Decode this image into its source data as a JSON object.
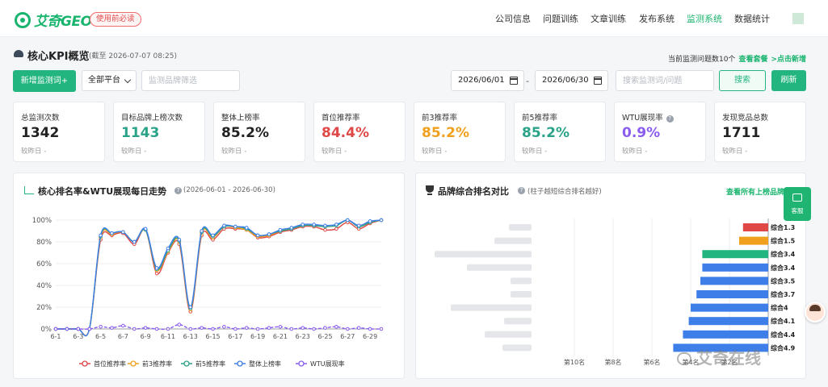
{
  "topnav": {
    "logo_text": "艾奇GEO",
    "must_read": "使用前必读",
    "items": [
      "公司信息",
      "问题训练",
      "文章训练",
      "发布系统",
      "监测系统",
      "数据统计"
    ],
    "active_index": 4
  },
  "header": {
    "title": "核心KPI概览",
    "as_of": "(截至 2026-07-07 08:25)",
    "monitor_count": "当前监测问题数10个",
    "view_plan": "查看套餐",
    "add_link": ">点击新增"
  },
  "toolbar": {
    "add_button": "新增监测词+",
    "platform_select": "全部平台",
    "brand_filter_placeholder": "监测品牌筛选",
    "date_start": "2026/06/01",
    "date_end": "2026/06/30",
    "date_sep": "-",
    "search_placeholder": "搜索监测词/问题",
    "search_button": "搜索",
    "refresh_button": "刷新"
  },
  "kpis": [
    {
      "label": "总监测次数",
      "value": "1342",
      "sub": "较昨日 -",
      "color": "#222222",
      "help": false
    },
    {
      "label": "目标品牌上榜次数",
      "value": "1143",
      "sub": "较昨日 -",
      "color": "#2aa388",
      "help": false
    },
    {
      "label": "整体上榜率",
      "value": "85.2%",
      "sub": "较昨日 -",
      "color": "#222222",
      "help": false
    },
    {
      "label": "首位推荐率",
      "value": "84.4%",
      "sub": "较昨日 -",
      "color": "#e04848",
      "help": false
    },
    {
      "label": "前3推荐率",
      "value": "85.2%",
      "sub": "较昨日 -",
      "color": "#f0a01c",
      "help": false
    },
    {
      "label": "前5推荐率",
      "value": "85.2%",
      "sub": "较昨日 -",
      "color": "#2aa388",
      "help": false
    },
    {
      "label": "WTU展现率",
      "value": "0.9%",
      "sub": "较昨日 -",
      "color": "#8a5cf0",
      "help": true
    },
    {
      "label": "发现竞品总数",
      "value": "1711",
      "sub": "较昨日 -",
      "color": "#222222",
      "help": false
    }
  ],
  "trend_panel": {
    "title": "核心排名率&WTU展现每日走势",
    "range": "(2026-06-01 - 2026-06-30)"
  },
  "ranking_panel": {
    "title": "品牌综合排名对比",
    "subtitle": "(柱子越短综合排名越好)",
    "view_all": "查看所有上榜品牌"
  },
  "chart_data": [
    {
      "type": "line",
      "title": "核心排名率&WTU展现每日走势",
      "x": [
        "6-1",
        "6-2",
        "6-3",
        "6-4",
        "6-5",
        "6-6",
        "6-7",
        "6-8",
        "6-9",
        "6-10",
        "6-11",
        "6-12",
        "6-13",
        "6-14",
        "6-15",
        "6-16",
        "6-17",
        "6-18",
        "6-19",
        "6-20",
        "6-21",
        "6-22",
        "6-23",
        "6-24",
        "6-25",
        "6-26",
        "6-27",
        "6-28",
        "6-29",
        "6-30"
      ],
      "x_tick_labels": [
        "6-1",
        "6-3",
        "6-5",
        "6-7",
        "6-9",
        "6-11",
        "6-13",
        "6-15",
        "6-17",
        "6-19",
        "6-21",
        "6-23",
        "6-25",
        "6-27",
        "6-29"
      ],
      "ylim": [
        0,
        100
      ],
      "y_ticks": [
        "0%",
        "20%",
        "40%",
        "60%",
        "80%",
        "100%"
      ],
      "legend_position": "bottom",
      "grid": true,
      "series": [
        {
          "name": "首位推荐率",
          "color": "#e04848",
          "values": [
            0,
            0,
            0,
            0,
            82,
            86,
            88,
            78,
            91,
            51,
            70,
            78,
            16,
            86,
            82,
            92,
            92,
            91,
            84,
            85,
            89,
            91,
            94,
            94,
            91,
            92,
            98,
            92,
            97,
            100
          ]
        },
        {
          "name": "前3推荐率",
          "color": "#f0a01c",
          "values": [
            0,
            0,
            0,
            0,
            84,
            87,
            89,
            80,
            91,
            54,
            71,
            80,
            18,
            88,
            84,
            94,
            93,
            91,
            85,
            86,
            90,
            92,
            95,
            95,
            94,
            95,
            100,
            94,
            98,
            100
          ]
        },
        {
          "name": "前5推荐率",
          "color": "#2aa388",
          "values": [
            0,
            0,
            0,
            0,
            85,
            88,
            89,
            80,
            91,
            55,
            72,
            81,
            19,
            89,
            85,
            94,
            94,
            92,
            86,
            87,
            90,
            92,
            95,
            95,
            94,
            95,
            100,
            94,
            98,
            100
          ]
        },
        {
          "name": "整体上榜率",
          "color": "#3d7ee8",
          "values": [
            0,
            0,
            0,
            0,
            86,
            88,
            89,
            80,
            92,
            56,
            74,
            82,
            20,
            90,
            86,
            95,
            94,
            93,
            86,
            87,
            91,
            93,
            96,
            96,
            95,
            96,
            100,
            95,
            99,
            100
          ]
        },
        {
          "name": "WTU展现率",
          "color": "#8a5cf0",
          "values": [
            0,
            0,
            0,
            0,
            2,
            1,
            3,
            0,
            1,
            0,
            0,
            4,
            0,
            1,
            0,
            2,
            0,
            1,
            0,
            1,
            2,
            0,
            1,
            0,
            1,
            2,
            0,
            1,
            0,
            0
          ]
        }
      ]
    },
    {
      "type": "bar",
      "orientation": "horizontal",
      "title": "品牌综合排名对比",
      "x_ticks": [
        "第10名",
        "第8名",
        "第6名",
        "第4名",
        "第2名"
      ],
      "series": [
        {
          "values": [
            1.3,
            1.5,
            3.4,
            3.4,
            3.5,
            3.7,
            4,
            4.1,
            4.4,
            4.9
          ],
          "labels": [
            "综合1.3",
            "综合1.5",
            "综合3.4",
            "综合3.4",
            "综合3.5",
            "综合3.7",
            "综合4",
            "综合4.1",
            "综合4.4",
            "综合4.9"
          ],
          "colors": [
            "#e04848",
            "#f0a01c",
            "#23b57f",
            "#3d7ee8",
            "#3d7ee8",
            "#3d7ee8",
            "#3d7ee8",
            "#3d7ee8",
            "#3d7ee8",
            "#3d7ee8"
          ]
        }
      ]
    }
  ],
  "widgets": {
    "kefu_label": "客服",
    "watermark": "艾奇在线"
  }
}
